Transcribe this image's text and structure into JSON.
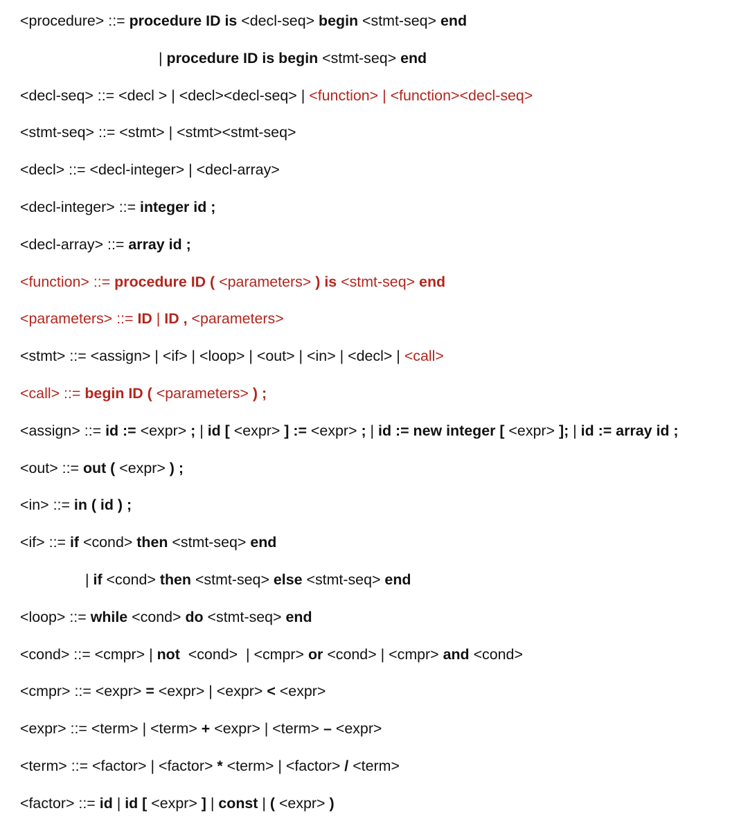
{
  "document": {
    "colors": {
      "text": "#111111",
      "highlight": "#b3261e"
    },
    "lines": [
      {
        "indent": 0,
        "segments": [
          {
            "t": "<procedure> ::= "
          },
          {
            "t": "procedure ID is",
            "b": true
          },
          {
            "t": " <decl-seq> "
          },
          {
            "t": "begin",
            "b": true
          },
          {
            "t": " <stmt-seq> "
          },
          {
            "t": "end",
            "b": true
          }
        ]
      },
      {
        "indent": 200,
        "segments": [
          {
            "t": "| "
          },
          {
            "t": "procedure ID is begin",
            "b": true
          },
          {
            "t": " <stmt-seq> "
          },
          {
            "t": "end",
            "b": true
          }
        ]
      },
      {
        "indent": 0,
        "segments": [
          {
            "t": "<decl-seq> ::= <decl > | <decl><decl-seq> | "
          },
          {
            "t": "<function> | <function><decl-seq>",
            "r": true
          }
        ]
      },
      {
        "indent": 0,
        "segments": [
          {
            "t": "<stmt-seq> ::= <stmt> | <stmt><stmt-seq>"
          }
        ]
      },
      {
        "indent": 0,
        "segments": [
          {
            "t": "<decl> ::= <decl-integer> | <decl-array>"
          }
        ]
      },
      {
        "indent": 0,
        "segments": [
          {
            "t": "<decl-integer> ::= "
          },
          {
            "t": "integer id ;",
            "b": true
          }
        ]
      },
      {
        "indent": 0,
        "segments": [
          {
            "t": "<decl-array> ::= "
          },
          {
            "t": "array id ;",
            "b": true
          }
        ]
      },
      {
        "indent": 0,
        "segments": [
          {
            "t": "<function> ::= ",
            "r": true
          },
          {
            "t": "procedure ID (",
            "b": true,
            "r": true
          },
          {
            "t": " <parameters> ",
            "r": true
          },
          {
            "t": ") is",
            "b": true,
            "r": true
          },
          {
            "t": " <stmt-seq> ",
            "r": true
          },
          {
            "t": "end",
            "b": true,
            "r": true
          }
        ]
      },
      {
        "indent": 0,
        "segments": [
          {
            "t": "<parameters> ::= ",
            "r": true
          },
          {
            "t": "ID",
            "b": true,
            "r": true
          },
          {
            "t": " | ",
            "r": true
          },
          {
            "t": "ID ,",
            "b": true,
            "r": true
          },
          {
            "t": " <parameters>",
            "r": true
          }
        ]
      },
      {
        "indent": 0,
        "segments": [
          {
            "t": "<stmt> ::= <assign> | <if> | <loop> | <out> | <in> | <decl> | "
          },
          {
            "t": "<call>",
            "r": true
          }
        ]
      },
      {
        "indent": 0,
        "segments": [
          {
            "t": "<call> ::= ",
            "r": true
          },
          {
            "t": "begin ID (",
            "b": true,
            "r": true
          },
          {
            "t": " <parameters> ",
            "r": true
          },
          {
            "t": ") ;",
            "b": true,
            "r": true
          }
        ]
      },
      {
        "indent": 0,
        "segments": [
          {
            "t": "<assign> ::= "
          },
          {
            "t": "id :=",
            "b": true
          },
          {
            "t": " <expr> "
          },
          {
            "t": ";",
            "b": true
          },
          {
            "t": " | "
          },
          {
            "t": "id [",
            "b": true
          },
          {
            "t": " <expr> "
          },
          {
            "t": "] :=",
            "b": true
          },
          {
            "t": " <expr> "
          },
          {
            "t": ";",
            "b": true
          },
          {
            "t": " | "
          },
          {
            "t": "id := new integer [",
            "b": true
          },
          {
            "t": " <expr> "
          },
          {
            "t": "];",
            "b": true
          },
          {
            "t": " | "
          },
          {
            "t": "id := array id ;",
            "b": true
          }
        ]
      },
      {
        "indent": 0,
        "segments": [
          {
            "t": "<out> ::= "
          },
          {
            "t": "out (",
            "b": true
          },
          {
            "t": " <expr> "
          },
          {
            "t": ") ;",
            "b": true
          }
        ]
      },
      {
        "indent": 0,
        "segments": [
          {
            "t": "<in> ::= "
          },
          {
            "t": "in ( id ) ;",
            "b": true
          }
        ]
      },
      {
        "indent": 0,
        "segments": [
          {
            "t": "<if> ::= "
          },
          {
            "t": "if",
            "b": true
          },
          {
            "t": " <cond> "
          },
          {
            "t": "then",
            "b": true
          },
          {
            "t": " <stmt-seq> "
          },
          {
            "t": "end",
            "b": true
          }
        ]
      },
      {
        "indent": 94,
        "segments": [
          {
            "t": "| "
          },
          {
            "t": "if",
            "b": true
          },
          {
            "t": " <cond> "
          },
          {
            "t": "then",
            "b": true
          },
          {
            "t": " <stmt-seq> "
          },
          {
            "t": "else",
            "b": true
          },
          {
            "t": " <stmt-seq> "
          },
          {
            "t": "end",
            "b": true
          }
        ]
      },
      {
        "indent": 0,
        "segments": [
          {
            "t": "<loop> ::= "
          },
          {
            "t": "while",
            "b": true
          },
          {
            "t": " <cond> "
          },
          {
            "t": "do",
            "b": true
          },
          {
            "t": " <stmt-seq> "
          },
          {
            "t": "end",
            "b": true
          }
        ]
      },
      {
        "indent": 0,
        "segments": [
          {
            "t": "<cond> ::= <cmpr> | "
          },
          {
            "t": "not",
            "b": true
          },
          {
            "t": "  <cond>  | <cmpr> "
          },
          {
            "t": "or",
            "b": true
          },
          {
            "t": " <cond> | <cmpr> "
          },
          {
            "t": "and",
            "b": true
          },
          {
            "t": " <cond>"
          }
        ]
      },
      {
        "indent": 0,
        "segments": [
          {
            "t": "<cmpr> ::= <expr> "
          },
          {
            "t": "=",
            "b": true
          },
          {
            "t": " <expr> | <expr> "
          },
          {
            "t": "<",
            "b": true
          },
          {
            "t": " <expr>"
          }
        ]
      },
      {
        "indent": 0,
        "segments": [
          {
            "t": "<expr> ::= <term> | <term> "
          },
          {
            "t": "+",
            "b": true
          },
          {
            "t": " <expr> | <term> "
          },
          {
            "t": "–",
            "b": true
          },
          {
            "t": " <expr>"
          }
        ]
      },
      {
        "indent": 0,
        "segments": [
          {
            "t": "<term> ::= <factor> | <factor> "
          },
          {
            "t": "*",
            "b": true
          },
          {
            "t": " <term> | <factor> "
          },
          {
            "t": "/",
            "b": true
          },
          {
            "t": " <term>"
          }
        ]
      },
      {
        "indent": 0,
        "segments": [
          {
            "t": "<factor> ::= "
          },
          {
            "t": "id",
            "b": true
          },
          {
            "t": " | "
          },
          {
            "t": "id [",
            "b": true
          },
          {
            "t": " <expr> "
          },
          {
            "t": "]",
            "b": true
          },
          {
            "t": " | "
          },
          {
            "t": "const",
            "b": true
          },
          {
            "t": " | "
          },
          {
            "t": "(",
            "b": true
          },
          {
            "t": " <expr> "
          },
          {
            "t": ")",
            "b": true
          }
        ]
      }
    ]
  }
}
